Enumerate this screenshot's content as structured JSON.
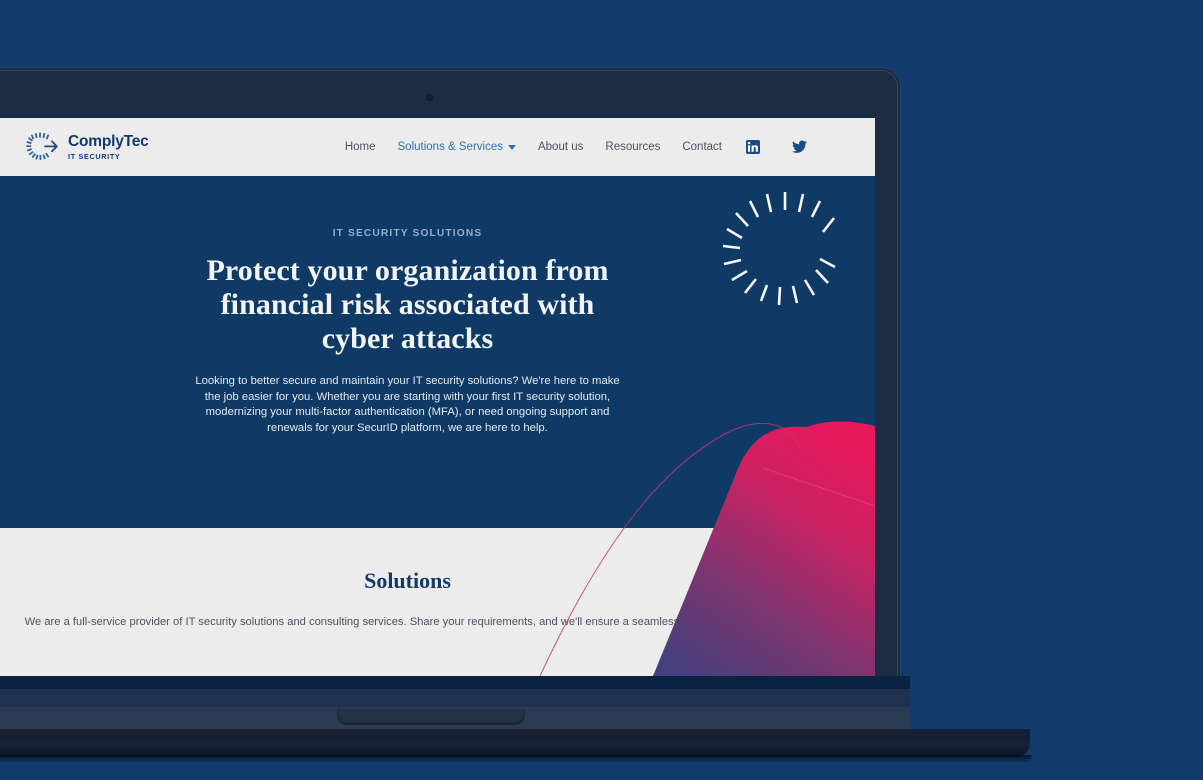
{
  "brand": {
    "name": "ComplyTec",
    "tagline": "IT SECURITY",
    "logo_icon": "radial-burst-arrow-icon",
    "color": "#123a6b"
  },
  "nav": {
    "items": [
      {
        "label": "Home",
        "active": false,
        "has_dropdown": false
      },
      {
        "label": "Solutions & Services",
        "active": true,
        "has_dropdown": true
      },
      {
        "label": "About us",
        "active": false,
        "has_dropdown": false
      },
      {
        "label": "Resources",
        "active": false,
        "has_dropdown": false
      },
      {
        "label": "Contact",
        "active": false,
        "has_dropdown": false
      }
    ],
    "social": [
      {
        "name": "linkedin-icon",
        "label": "LinkedIn"
      },
      {
        "name": "twitter-icon",
        "label": "Twitter"
      }
    ],
    "active_color": "#3072b0",
    "link_color": "#4b5360"
  },
  "hero": {
    "eyebrow": "IT SECURITY SOLUTIONS",
    "title": "Protect your organization from financial risk associated with cyber attacks",
    "paragraph": "Looking to better secure and maintain your IT security solutions? We're here to make the job easier for you. Whether you are starting with your first IT security solution, modernizing your multi-factor authentication (MFA), or need ongoing support and renewals for your SecurID platform, we are here to help.",
    "background_color": "#0f3a66",
    "eyebrow_color": "#8fb0cf",
    "title_color": "#f2f4f6"
  },
  "solutions": {
    "title": "Solutions",
    "paragraph": "We are a full-service provider of IT security solutions and consulting services. Share your requirements, and we'll ensure a seamless and effective solution.",
    "background_color": "#ececec",
    "title_color": "#123a6b",
    "text_color": "#4b5360"
  },
  "decor": {
    "blob_top_color": "#e0215f",
    "blob_bottom_color": "#4a3f7a",
    "burst_icon": "radial-burst-icon",
    "line_color": "#c8346a"
  },
  "device": {
    "type": "laptop-mockup",
    "bezel_color": "#1c2c45",
    "page_background": "#123a6b"
  }
}
